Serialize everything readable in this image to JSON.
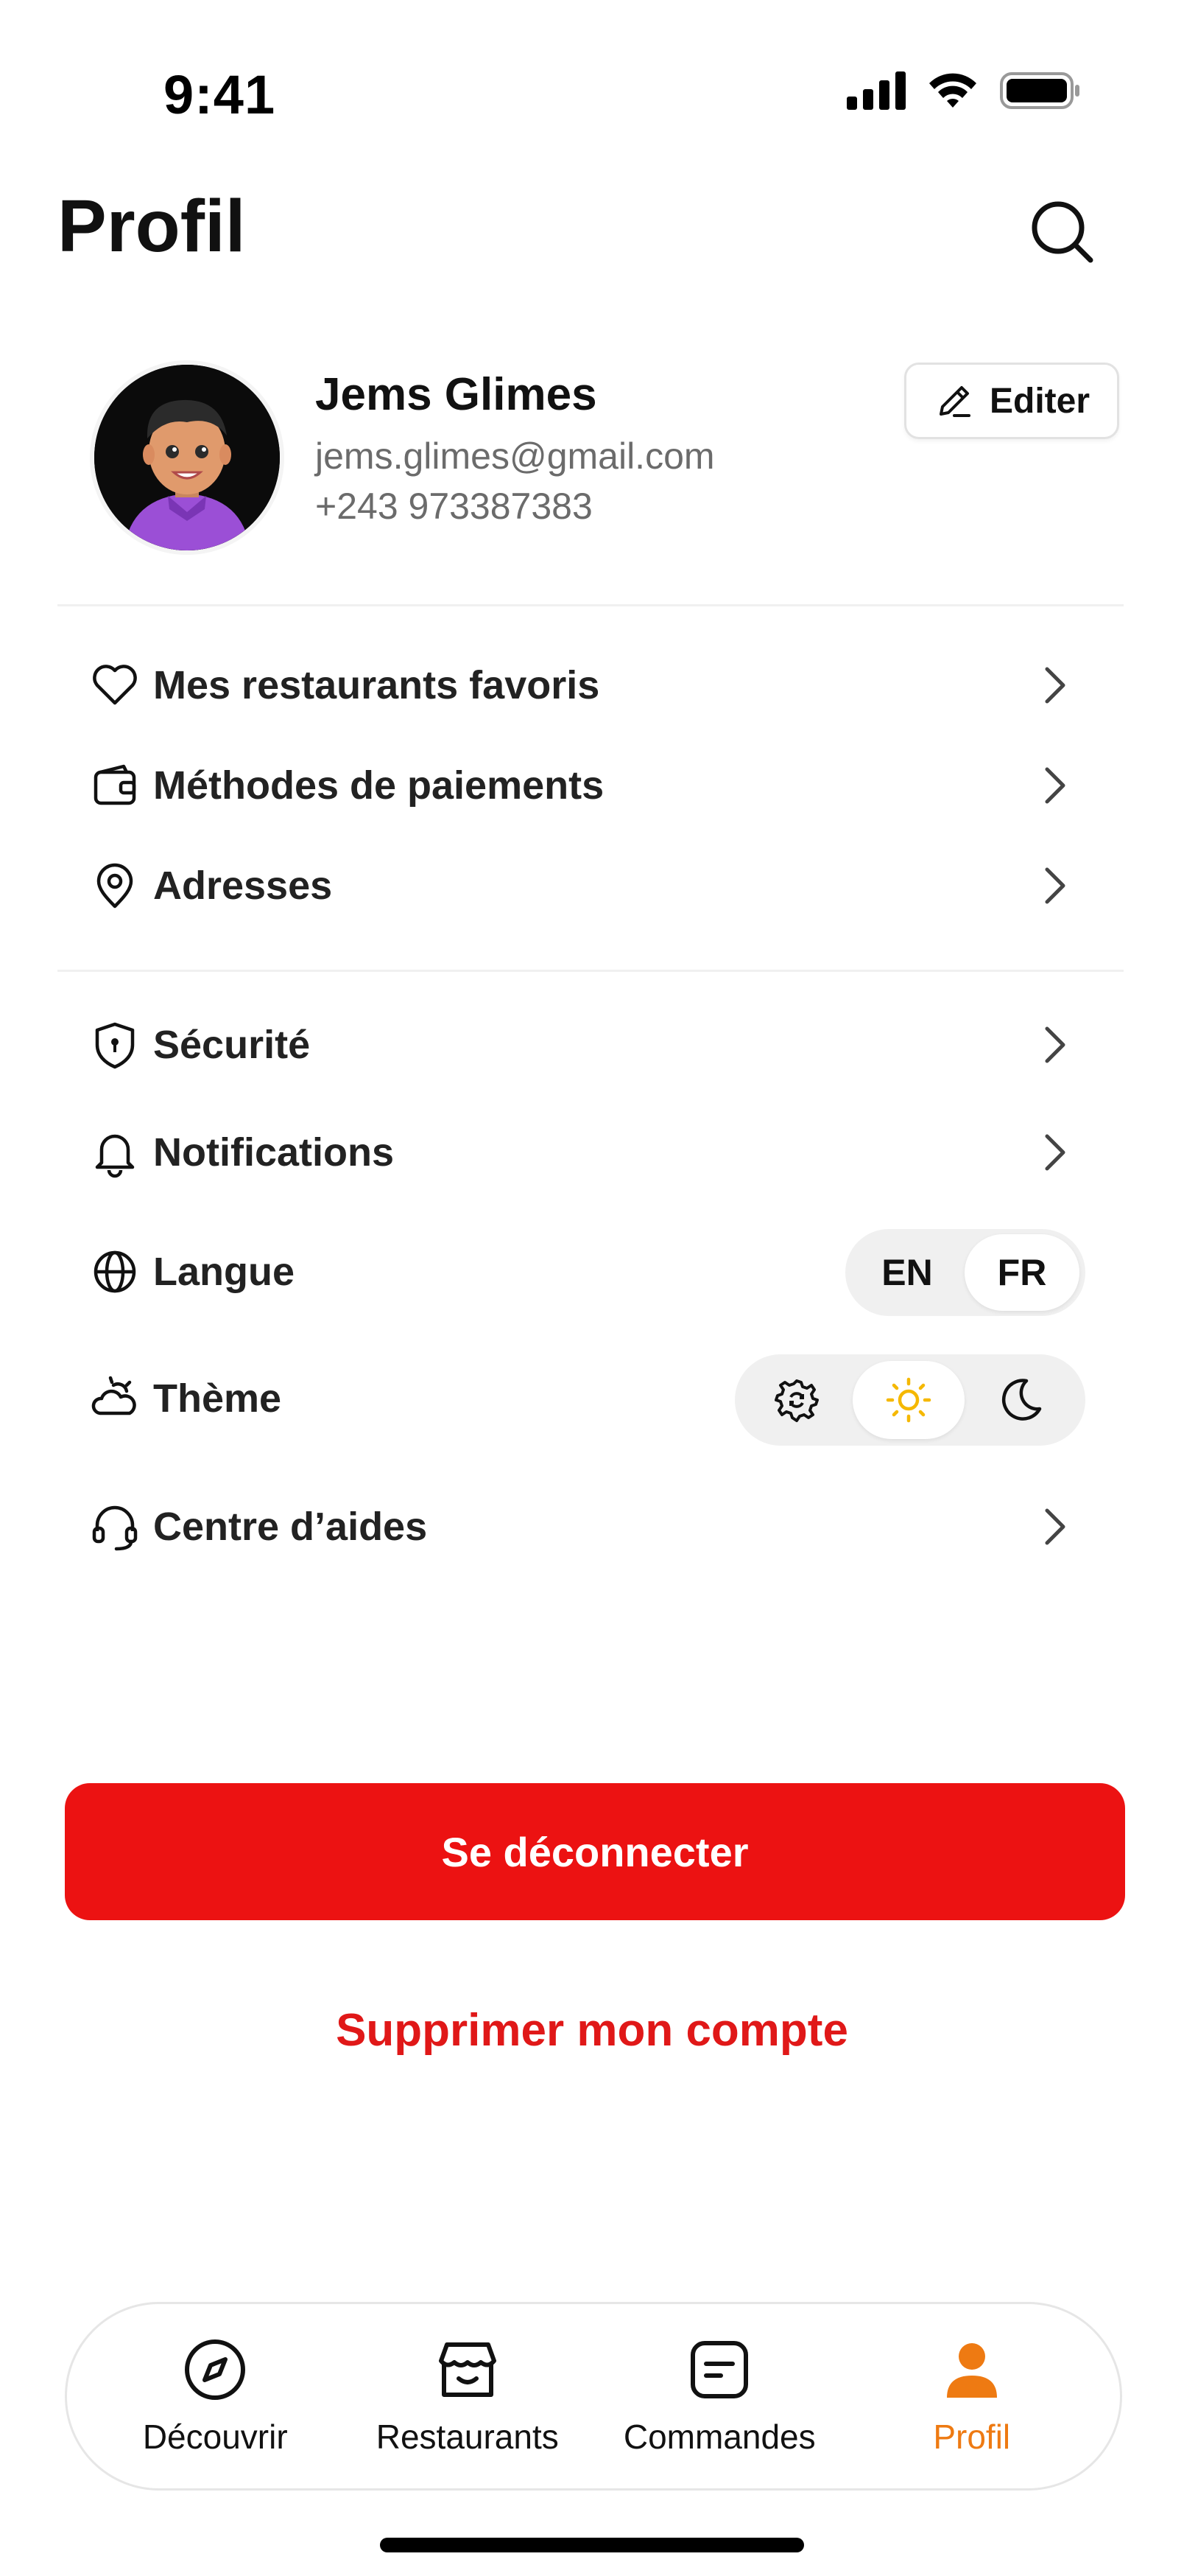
{
  "status_bar": {
    "time": "9:41"
  },
  "header": {
    "title": "Profil"
  },
  "profile": {
    "name": "Jems Glimes",
    "email": "jems.glimes@gmail.com",
    "phone": "+243 973387383",
    "edit_label": "Editer"
  },
  "menu_group_1": [
    {
      "label": "Mes restaurants favoris",
      "icon": "heart-icon"
    },
    {
      "label": "Méthodes de paiements",
      "icon": "wallet-icon"
    },
    {
      "label": "Adresses",
      "icon": "location-pin-icon"
    }
  ],
  "menu_group_2": {
    "security": {
      "label": "Sécurité",
      "icon": "shield-lock-icon"
    },
    "notifications": {
      "label": "Notifications",
      "icon": "bell-icon"
    },
    "language": {
      "label": "Langue",
      "icon": "globe-icon",
      "options": [
        "EN",
        "FR"
      ],
      "selected": "FR"
    },
    "theme": {
      "label": "Thème",
      "icon": "cloud-sun-icon",
      "options": [
        "system-icon",
        "sun-icon",
        "moon-icon"
      ],
      "selected": "sun-icon"
    },
    "help": {
      "label": "Centre d’aides",
      "icon": "headset-icon"
    }
  },
  "actions": {
    "logout": "Se déconnecter",
    "delete_account": "Supprimer mon compte"
  },
  "bottom_nav": [
    {
      "label": "Découvrir",
      "icon": "compass-icon"
    },
    {
      "label": "Restaurants",
      "icon": "store-icon"
    },
    {
      "label": "Commandes",
      "icon": "order-icon"
    },
    {
      "label": "Profil",
      "icon": "user-icon",
      "active": true
    }
  ],
  "colors": {
    "primary_red": "#ec1212",
    "active_orange": "#ee7a12",
    "sun_yellow": "#f5b800"
  }
}
